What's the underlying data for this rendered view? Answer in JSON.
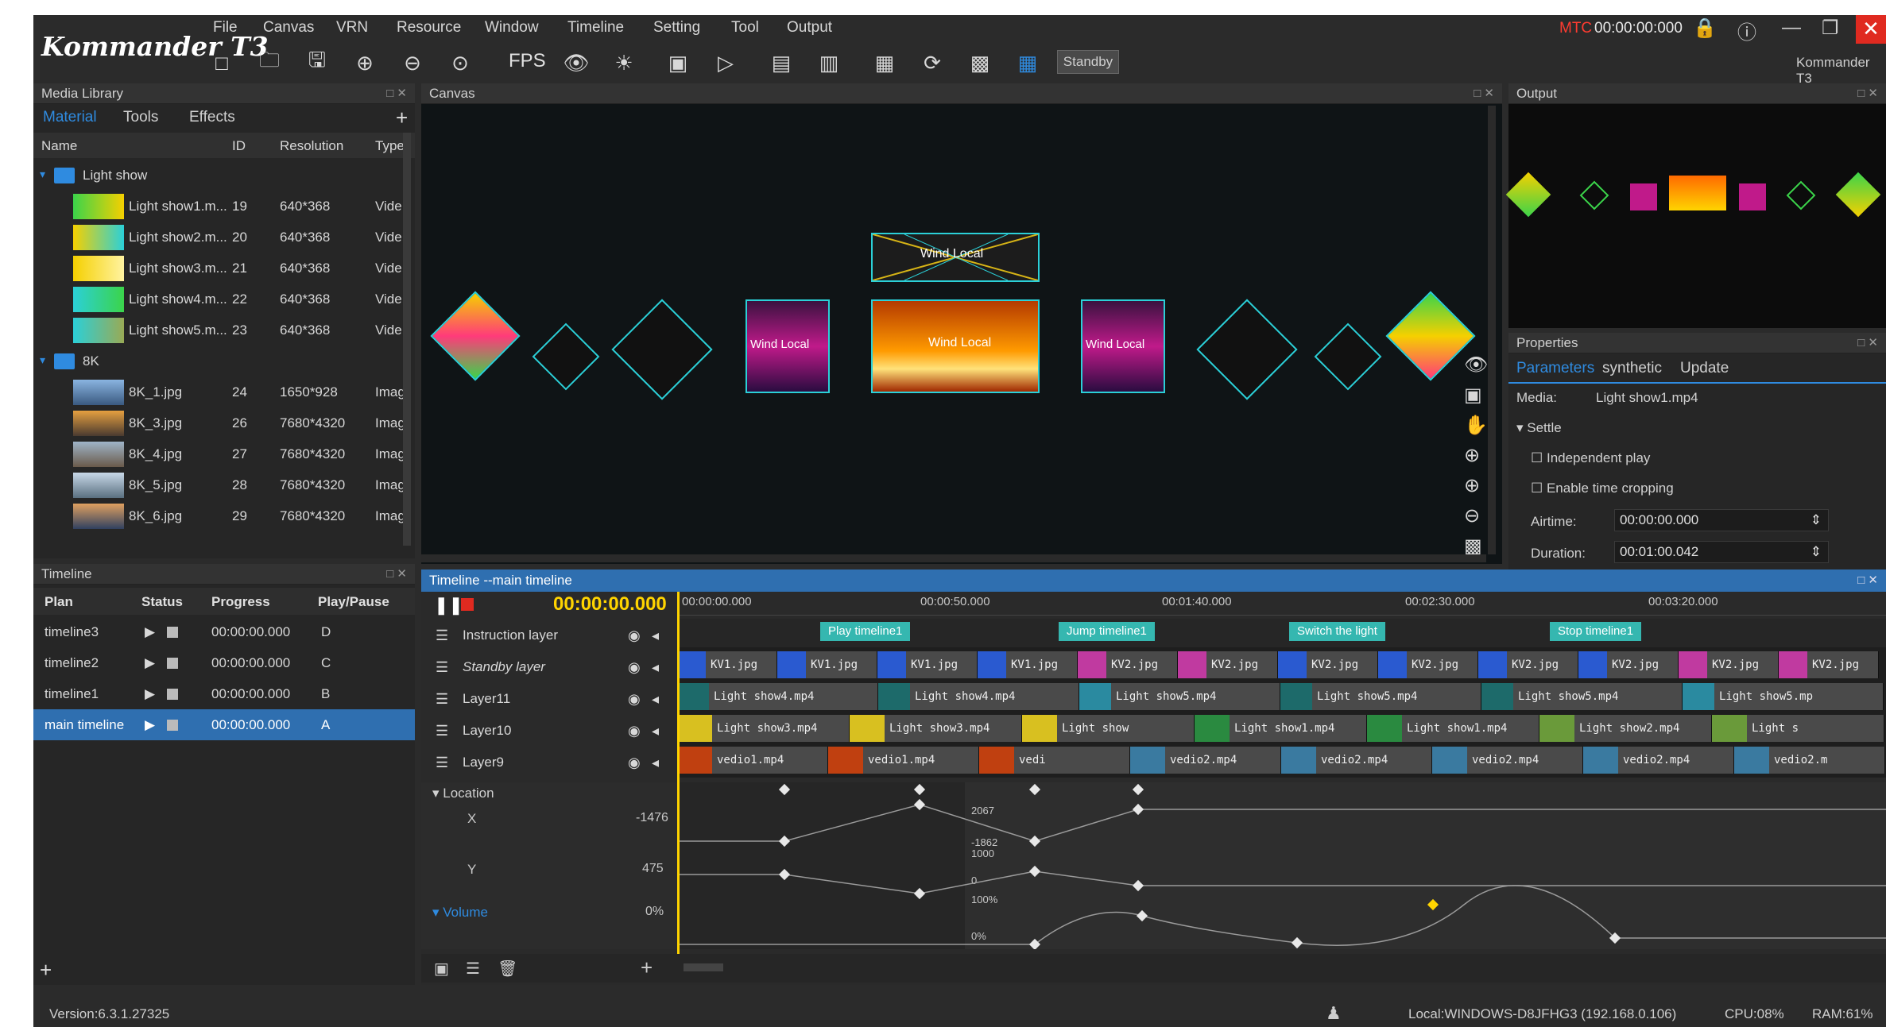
{
  "app": {
    "logo": "Kommander T3",
    "brand": "Kommander T3",
    "mtc_label": "MTC",
    "mtc_time": "00:00:00:000",
    "standby": "Standby",
    "fps": "FPS"
  },
  "menu": [
    "File",
    "Canvas",
    "VRN",
    "Resource",
    "Window",
    "Timeline",
    "Setting",
    "Tool",
    "Output"
  ],
  "media_library": {
    "title": "Media Library",
    "tabs": [
      "Material",
      "Tools",
      "Effects"
    ],
    "columns": [
      "Name",
      "ID",
      "Resolution",
      "Type"
    ],
    "folders": [
      {
        "name": "Light show",
        "items": [
          {
            "name": "Light show1.m...",
            "id": "19",
            "res": "640*368",
            "type": "Vide"
          },
          {
            "name": "Light show2.m...",
            "id": "20",
            "res": "640*368",
            "type": "Vide"
          },
          {
            "name": "Light show3.m...",
            "id": "21",
            "res": "640*368",
            "type": "Vide"
          },
          {
            "name": "Light show4.m...",
            "id": "22",
            "res": "640*368",
            "type": "Vide"
          },
          {
            "name": "Light show5.m...",
            "id": "23",
            "res": "640*368",
            "type": "Vide"
          }
        ]
      },
      {
        "name": "8K",
        "items": [
          {
            "name": "8K_1.jpg",
            "id": "24",
            "res": "1650*928",
            "type": "Imag"
          },
          {
            "name": "8K_3.jpg",
            "id": "26",
            "res": "7680*4320",
            "type": "Imag"
          },
          {
            "name": "8K_4.jpg",
            "id": "27",
            "res": "7680*4320",
            "type": "Imag"
          },
          {
            "name": "8K_5.jpg",
            "id": "28",
            "res": "7680*4320",
            "type": "Imag"
          },
          {
            "name": "8K_6.jpg",
            "id": "29",
            "res": "7680*4320",
            "type": "Imag"
          }
        ]
      }
    ]
  },
  "canvas": {
    "title": "Canvas",
    "screen_label": "Wind Local"
  },
  "output": {
    "title": "Output"
  },
  "properties": {
    "title": "Properties",
    "tabs": [
      "Parameters",
      "synthetic",
      "Update"
    ],
    "media_label": "Media:",
    "media_value": "Light show1.mp4",
    "section": "Settle",
    "independent_play": "Independent play",
    "enable_cropping": "Enable time cropping",
    "airtime_label": "Airtime:",
    "airtime_value": "00:00:00.000",
    "duration_label": "Duration:",
    "duration_value": "00:01:00.042"
  },
  "timeline_list": {
    "title": "Timeline",
    "columns": [
      "Plan",
      "Status",
      "Progress",
      "Play/Pause"
    ],
    "rows": [
      {
        "plan": "timeline3",
        "progress": "00:00:00.000",
        "key": "D"
      },
      {
        "plan": "timeline2",
        "progress": "00:00:00.000",
        "key": "C"
      },
      {
        "plan": "timeline1",
        "progress": "00:00:00.000",
        "key": "B"
      },
      {
        "plan": "main timeline",
        "progress": "00:00:00.000",
        "key": "A"
      }
    ]
  },
  "main_timeline": {
    "title": "Timeline --main timeline",
    "current_time": "00:00:00.000",
    "ticks": [
      "00:00:00.000",
      "00:00:50.000",
      "00:01:40.000",
      "00:02:30.000",
      "00:03:20.000"
    ],
    "layers": [
      "Instruction layer",
      "Standby layer",
      "Layer11",
      "Layer10",
      "Layer9"
    ],
    "cues": [
      "Play timeline1",
      "Jump timeline1",
      "Switch the light",
      "Stop timeline1"
    ],
    "standby_clips": [
      "KV1.jpg",
      "KV1.jpg",
      "KV1.jpg",
      "KV1.jpg",
      "KV2.jpg",
      "KV2.jpg",
      "KV2.jpg",
      "KV2.jpg",
      "KV2.jpg",
      "KV2.jpg",
      "KV2.jpg",
      "KV2.jpg"
    ],
    "layer11_clips": [
      "Light show4.mp4",
      "Light show4.mp4",
      "Light show5.mp4",
      "Light show5.mp4",
      "Light show5.mp4",
      "Light show5.mp"
    ],
    "layer10_clips": [
      "Light show3.mp4",
      "Light show3.mp4",
      "Light show",
      "Light show1.mp4",
      "Light show1.mp4",
      "Light show2.mp4",
      "Light s"
    ],
    "layer9_clips": [
      "vedio1.mp4",
      "vedio1.mp4",
      "vedi",
      "vedio2.mp4",
      "vedio2.mp4",
      "vedio2.mp4",
      "vedio2.mp4",
      "vedio2.m"
    ],
    "location_label": "Location",
    "x_label": "X",
    "x_value": "-1476",
    "y_label": "Y",
    "y_value": "475",
    "kf_labels": [
      "2067",
      "-1862",
      "1000",
      "0",
      "100%",
      "0%"
    ],
    "volume_label": "Volume",
    "volume_value": "0%"
  },
  "status": {
    "version": "Version:6.3.1.27325",
    "host": "Local:WINDOWS-D8JFHG3 (192.168.0.106)",
    "cpu": "CPU:08%",
    "ram": "RAM:61%"
  },
  "colors": {
    "accent": "#2f8be0",
    "timeline_header": "#2f6fb0",
    "cue": "#35b7b0",
    "time": "#ffd400",
    "mtc": "#ff3b30"
  }
}
